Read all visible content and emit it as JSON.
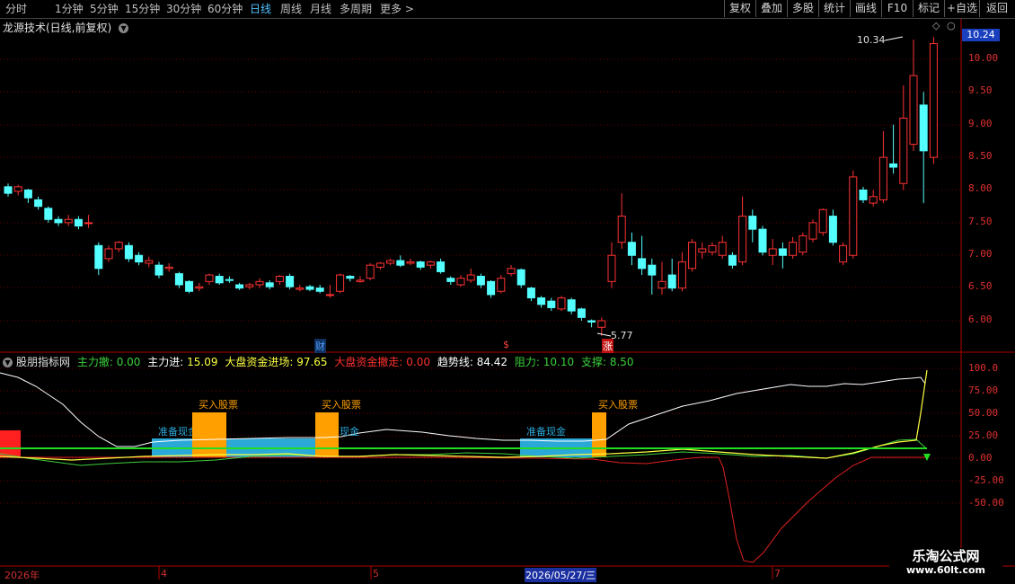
{
  "toolbar": {
    "periods": [
      "分时",
      "1分钟",
      "5分钟",
      "15分钟",
      "30分钟",
      "60分钟",
      "日线",
      "周线",
      "月线",
      "多周期",
      "更多"
    ],
    "active_period": "日线",
    "buttons": [
      "复权",
      "叠加",
      "多股",
      "统计",
      "画线",
      "F10",
      "标记",
      "+自选",
      "返回"
    ]
  },
  "main_chart": {
    "title": "龙源技术(日线,前复权)",
    "current_price": "10.24",
    "high_label": "10.34",
    "low_label": "5.77",
    "y_ticks": [
      "10.00",
      "9.50",
      "9.00",
      "8.50",
      "8.00",
      "7.50",
      "7.00",
      "6.50",
      "6.00"
    ],
    "markers": [
      {
        "text": "财",
        "color": "#4fa0ff"
      },
      {
        "text": "$",
        "color": "#ff4040"
      },
      {
        "text": "涨",
        "color": "#ffffff"
      }
    ]
  },
  "indicator": {
    "name": "股朋指标网",
    "items": [
      {
        "label": "主力撤:",
        "value": "0.00",
        "color": "#3cd03c"
      },
      {
        "label": "主力进:",
        "value": "15.09",
        "color": "#ffffff"
      },
      {
        "label": "大盘资金进场:",
        "value": "97.65",
        "color": "#ffff40"
      },
      {
        "label": "大盘资金撤走:",
        "value": "0.00",
        "color": "#ff3030"
      },
      {
        "label": "趋势线:",
        "value": "84.42",
        "color": "#ffffff"
      },
      {
        "label": "阻力:",
        "value": "10.10",
        "color": "#3cd03c"
      },
      {
        "label": "支撑:",
        "value": "8.50",
        "color": "#3cd03c"
      }
    ],
    "y_ticks": [
      "100.0",
      "75.00",
      "50.00",
      "25.00",
      "0.00",
      "-25.00",
      "-50.00"
    ],
    "buy_label": "买入股票",
    "cash_label": "准备现金",
    "cash_label_partial": "现金"
  },
  "date_axis": {
    "labels": [
      "2026年",
      "4",
      "5",
      "2026/05/27/三",
      "7"
    ]
  },
  "watermark": {
    "name": "乐淘公式网",
    "url": "www.60lt.com"
  },
  "colors": {
    "up": "#ff3232",
    "down": "#54ffff",
    "axis": "#b00000",
    "buy_box": "#ffa000",
    "cash_box": "#2aa8d8"
  }
}
